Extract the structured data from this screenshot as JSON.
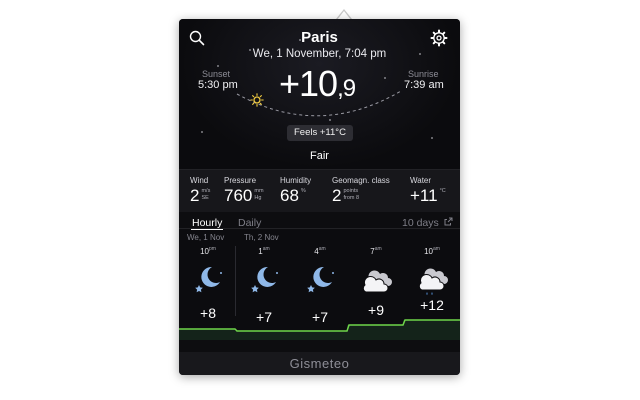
{
  "header": {
    "city": "Paris",
    "datetime": "We, 1 November, 7:04 pm",
    "sunset_label": "Sunset",
    "sunset_time": "5:30 pm",
    "sunrise_label": "Sunrise",
    "sunrise_time": "7:39 am",
    "temp_int": "+10",
    "temp_frac": ",9",
    "feels_like": "Feels +11°C",
    "condition": "Fair"
  },
  "stats": {
    "wind": {
      "label": "Wind",
      "value": "2",
      "unit_top": "m/s",
      "unit_bottom": "SE"
    },
    "pressure": {
      "label": "Pressure",
      "value": "760",
      "unit_top": "mm",
      "unit_bottom": "Hg"
    },
    "humidity": {
      "label": "Humidity",
      "value": "68",
      "unit_top": "%",
      "unit_bottom": ""
    },
    "geomagn": {
      "label": "Geomagn. class",
      "value": "2",
      "unit_top": "points",
      "unit_bottom": "from 8"
    },
    "water": {
      "label": "Water",
      "value": "+11",
      "unit_top": "°C",
      "unit_bottom": ""
    }
  },
  "tabs": {
    "hourly": "Hourly",
    "daily": "Daily",
    "ten_days": "10 days"
  },
  "forecast": {
    "days": [
      "We, 1 Nov",
      "Th, 2 Nov"
    ],
    "hours": [
      {
        "hour": "10",
        "period": "pm",
        "temp": "+8",
        "icon": "moon-stars-icon"
      },
      {
        "hour": "1",
        "period": "am",
        "temp": "+7",
        "icon": "moon-stars-icon"
      },
      {
        "hour": "4",
        "period": "am",
        "temp": "+7",
        "icon": "moon-stars-icon"
      },
      {
        "hour": "7",
        "period": "am",
        "temp": "+9",
        "icon": "cloudy-icon"
      },
      {
        "hour": "10",
        "period": "am",
        "temp": "+12",
        "icon": "cloud-rain-icon"
      }
    ]
  },
  "footer": {
    "brand": "Gismeteo"
  },
  "colors": {
    "background": "#0d0d10",
    "graph_line": "#6fd64a",
    "moon": "#8fb8e8",
    "sun": "#f2cc40"
  }
}
